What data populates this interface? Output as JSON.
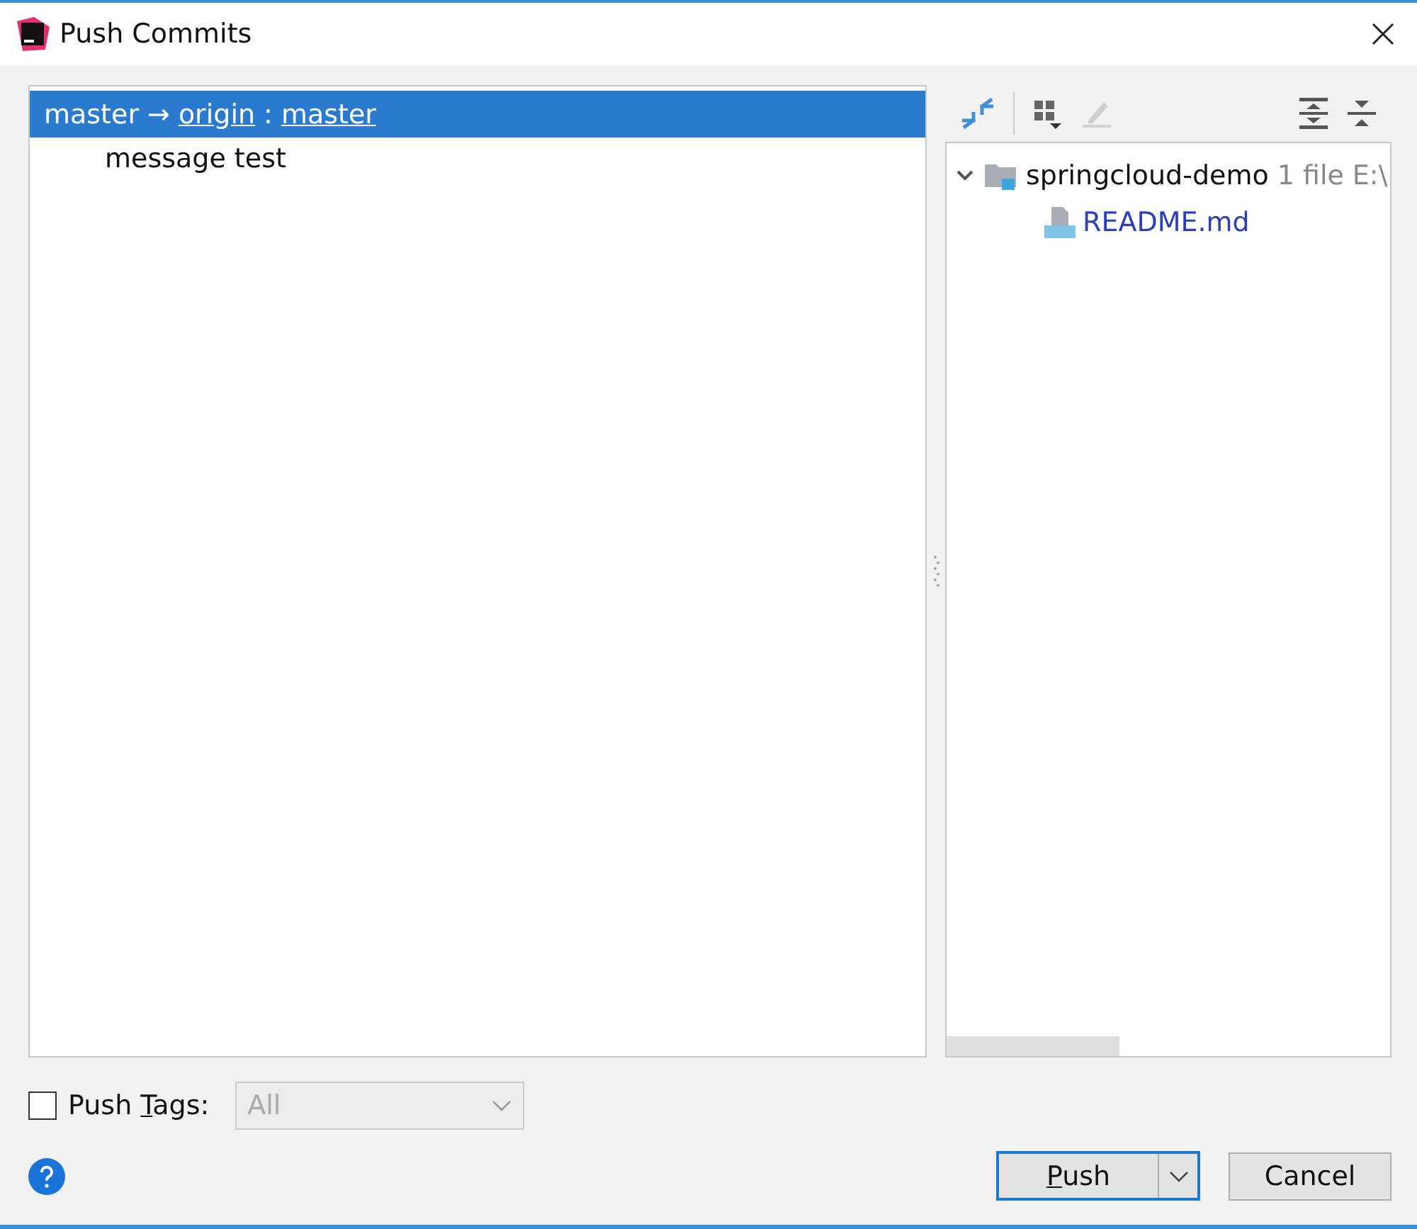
{
  "window": {
    "title": "Push Commits"
  },
  "push_list": {
    "branch": {
      "source": "master",
      "arrow": "→",
      "remote": "origin",
      "separator": ":",
      "target": "master",
      "selected": true
    },
    "commits": [
      {
        "message": "message test",
        "selected": false
      }
    ]
  },
  "changes_tree": [
    {
      "name": "springcloud-demo",
      "count": "1 file",
      "path": "E:\\",
      "expanded": true,
      "kind": "folder",
      "children": [
        {
          "name": "README.md",
          "kind": "file"
        }
      ]
    }
  ],
  "push_tags": {
    "checked": false,
    "label": [
      "Push ",
      "T",
      "ags:"
    ],
    "dropdown": {
      "value": "All",
      "disabled": true
    }
  },
  "buttons": {
    "push": {
      "mnemonic": "P",
      "rest": "ush"
    },
    "cancel": "Cancel"
  }
}
